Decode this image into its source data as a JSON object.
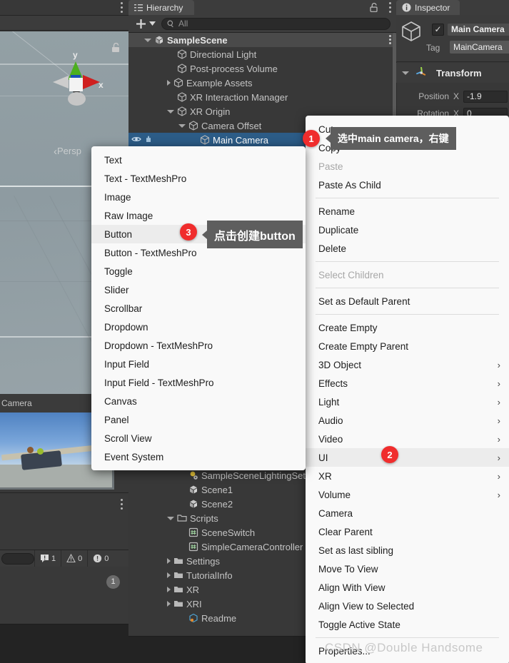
{
  "scene_view": {
    "gizmo": {
      "y_label": "y",
      "x_label": "x"
    },
    "perspective_label": "Persp",
    "lock_icon": "lock-open-icon",
    "kebab_icon": "kebab-menu-icon"
  },
  "camera_preview": {
    "title": "Camera"
  },
  "console": {
    "search_placeholder": "",
    "log_count": "1",
    "warning_count": "0",
    "error_count": "0",
    "badge": "1"
  },
  "hierarchy": {
    "tab_label": "Hierarchy",
    "tab_icon": "hierarchy-icon",
    "lock_icon": "lock-open-icon",
    "kebab_icon": "kebab-menu-icon",
    "add_label": "+",
    "search_placeholder": "All",
    "search_icon": "search-icon",
    "items": [
      {
        "label": "SampleScene",
        "depth": 0,
        "tri": "open",
        "icon": "unity-scene-icon",
        "state": "scene"
      },
      {
        "label": "Directional Light",
        "depth": 2,
        "tri": "blank",
        "icon": "cube-icon",
        "state": "normal"
      },
      {
        "label": "Post-process Volume",
        "depth": 2,
        "tri": "blank",
        "icon": "cube-icon",
        "state": "normal"
      },
      {
        "label": "Example Assets",
        "depth": 2,
        "tri": "closed",
        "icon": "cube-icon",
        "state": "normal"
      },
      {
        "label": "XR Interaction Manager",
        "depth": 2,
        "tri": "blank",
        "icon": "cube-icon",
        "state": "normal"
      },
      {
        "label": "XR Origin",
        "depth": 2,
        "tri": "open",
        "icon": "cube-icon",
        "state": "normal"
      },
      {
        "label": "Camera Offset",
        "depth": 3,
        "tri": "open",
        "icon": "cube-icon",
        "state": "normal"
      },
      {
        "label": "Main Camera",
        "depth": 4,
        "tri": "blank",
        "icon": "cube-icon",
        "state": "selected"
      }
    ],
    "project_items": [
      {
        "label": "SampleSceneLightingSettings",
        "depth": 3,
        "tri": "blank",
        "icon": "lighting-settings-icon"
      },
      {
        "label": "Scene1",
        "depth": 3,
        "tri": "blank",
        "icon": "unity-scene-icon"
      },
      {
        "label": "Scene2",
        "depth": 3,
        "tri": "blank",
        "icon": "unity-scene-icon"
      },
      {
        "label": "Scripts",
        "depth": 2,
        "tri": "open",
        "icon": "folder-open-icon"
      },
      {
        "label": "SceneSwitch",
        "depth": 3,
        "tri": "blank",
        "icon": "csharp-script-icon"
      },
      {
        "label": "SimpleCameraController",
        "depth": 3,
        "tri": "blank",
        "icon": "csharp-script-icon"
      },
      {
        "label": "Settings",
        "depth": 2,
        "tri": "closed",
        "icon": "folder-icon"
      },
      {
        "label": "TutorialInfo",
        "depth": 2,
        "tri": "closed",
        "icon": "folder-icon"
      },
      {
        "label": "XR",
        "depth": 2,
        "tri": "closed",
        "icon": "folder-icon"
      },
      {
        "label": "XRI",
        "depth": 2,
        "tri": "closed",
        "icon": "folder-icon"
      },
      {
        "label": "Readme",
        "depth": 3,
        "tri": "blank",
        "icon": "readme-asset-icon"
      }
    ]
  },
  "inspector": {
    "tab_label": "Inspector",
    "tab_icon": "info-icon",
    "object_icon": "cube-icon",
    "enabled_checkmark": "✓",
    "object_name": "Main Camera",
    "tag_label": "Tag",
    "tag_value": "MainCamera",
    "transform": {
      "title": "Transform",
      "icon": "transform-axis-icon",
      "rows": [
        {
          "label": "Position",
          "axis": "X",
          "value": "-1.9"
        },
        {
          "label": "Rotation",
          "axis": "X",
          "value": "0"
        }
      ]
    }
  },
  "context_menu": {
    "items": [
      {
        "label": "Cut",
        "type": "item"
      },
      {
        "label": "Copy",
        "type": "item"
      },
      {
        "label": "Paste",
        "type": "disabled"
      },
      {
        "label": "Paste As Child",
        "type": "item"
      },
      {
        "label": "",
        "type": "sep"
      },
      {
        "label": "Rename",
        "type": "item"
      },
      {
        "label": "Duplicate",
        "type": "item"
      },
      {
        "label": "Delete",
        "type": "item"
      },
      {
        "label": "",
        "type": "sep"
      },
      {
        "label": "Select Children",
        "type": "disabled"
      },
      {
        "label": "",
        "type": "sep"
      },
      {
        "label": "Set as Default Parent",
        "type": "item"
      },
      {
        "label": "",
        "type": "sep"
      },
      {
        "label": "Create Empty",
        "type": "item"
      },
      {
        "label": "Create Empty Parent",
        "type": "item"
      },
      {
        "label": "3D Object",
        "type": "submenu"
      },
      {
        "label": "Effects",
        "type": "submenu"
      },
      {
        "label": "Light",
        "type": "submenu"
      },
      {
        "label": "Audio",
        "type": "submenu"
      },
      {
        "label": "Video",
        "type": "submenu"
      },
      {
        "label": "UI",
        "type": "submenu",
        "highlight": true
      },
      {
        "label": "XR",
        "type": "submenu"
      },
      {
        "label": "Volume",
        "type": "submenu"
      },
      {
        "label": "Camera",
        "type": "item"
      },
      {
        "label": "Clear Parent",
        "type": "item"
      },
      {
        "label": "Set as last sibling",
        "type": "item"
      },
      {
        "label": "Move To View",
        "type": "item"
      },
      {
        "label": "Align With View",
        "type": "item"
      },
      {
        "label": "Align View to Selected",
        "type": "item"
      },
      {
        "label": "Toggle Active State",
        "type": "item"
      },
      {
        "label": "",
        "type": "sep"
      },
      {
        "label": "Properties...",
        "type": "item"
      }
    ],
    "submenu_arrow": "chevron-right-icon"
  },
  "ui_submenu": {
    "items": [
      {
        "label": "Text"
      },
      {
        "label": "Text - TextMeshPro"
      },
      {
        "label": "Image"
      },
      {
        "label": "Raw Image"
      },
      {
        "label": "Button",
        "highlight": true
      },
      {
        "label": "Button - TextMeshPro"
      },
      {
        "label": "Toggle"
      },
      {
        "label": "Slider"
      },
      {
        "label": "Scrollbar"
      },
      {
        "label": "Dropdown"
      },
      {
        "label": "Dropdown - TextMeshPro"
      },
      {
        "label": "Input Field"
      },
      {
        "label": "Input Field - TextMeshPro"
      },
      {
        "label": "Canvas"
      },
      {
        "label": "Panel"
      },
      {
        "label": "Scroll View"
      },
      {
        "label": "Event System"
      }
    ]
  },
  "annotations": {
    "step1_number": "1",
    "step1_text": "选中main camera，右键",
    "step2_number": "2",
    "step3_number": "3",
    "step3_text": "点击创建button"
  },
  "watermark": "CSDN @Double  Handsome",
  "colors": {
    "accent_red": "#f02d2d",
    "selection_blue": "#2c5c87",
    "menu_bg": "#f9f9f9",
    "callout_bg": "#5e5e5e",
    "editor_bg": "#383838"
  }
}
